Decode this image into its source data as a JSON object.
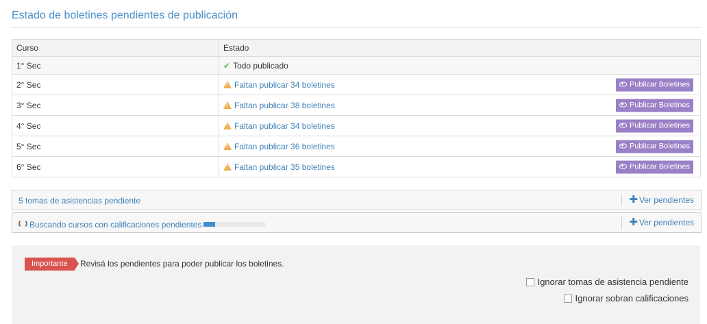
{
  "page": {
    "title": "Estado de boletines pendientes de publicación"
  },
  "table": {
    "headers": [
      "Curso",
      "Estado"
    ],
    "rows": [
      {
        "curso": "1° Sec",
        "estado": "Todo publicado",
        "status": "ok"
      },
      {
        "curso": "2° Sec",
        "estado": "Faltan publicar 34 boletines",
        "status": "pending",
        "action": "Publicar Boletines"
      },
      {
        "curso": "3° Sec",
        "estado": "Faltan publicar 38 boletines",
        "status": "pending",
        "action": "Publicar Boletines"
      },
      {
        "curso": "4° Sec",
        "estado": "Faltan publicar 34 boletines",
        "status": "pending",
        "action": "Publicar Boletines"
      },
      {
        "curso": "5° Sec",
        "estado": "Faltan publicar 36 boletines",
        "status": "pending",
        "action": "Publicar Boletines"
      },
      {
        "curso": "6° Sec",
        "estado": "Faltan publicar 35 boletines",
        "status": "pending",
        "action": "Publicar Boletines"
      }
    ]
  },
  "panels": {
    "asistencias": {
      "text": "5 tomas de asistencias pendiente",
      "link": "Ver pendientes"
    },
    "calificaciones": {
      "text": "Buscando cursos con calificaciones pendientes",
      "progress": 0.18,
      "link": "Ver pendientes"
    }
  },
  "notice": {
    "badge": "Importante",
    "text": "Revisá los pendientes para poder publicar los boletines.",
    "options": [
      {
        "label": "Ignorar tomas de asistencia pendiente",
        "checked": false
      },
      {
        "label": "Ignorar sobran calificaciones",
        "checked": false
      }
    ]
  },
  "colors": {
    "title": "#4a8fc7",
    "link": "#3e80b8",
    "button": "#9a80c6",
    "warning": "#f0ad4e",
    "success": "#5cb85c",
    "badge": "#d9534f"
  },
  "icons": {
    "ok": "check-icon",
    "pending": "warning-icon",
    "button": "eye-icon",
    "add": "plus-icon",
    "loading": "refresh-icon"
  }
}
